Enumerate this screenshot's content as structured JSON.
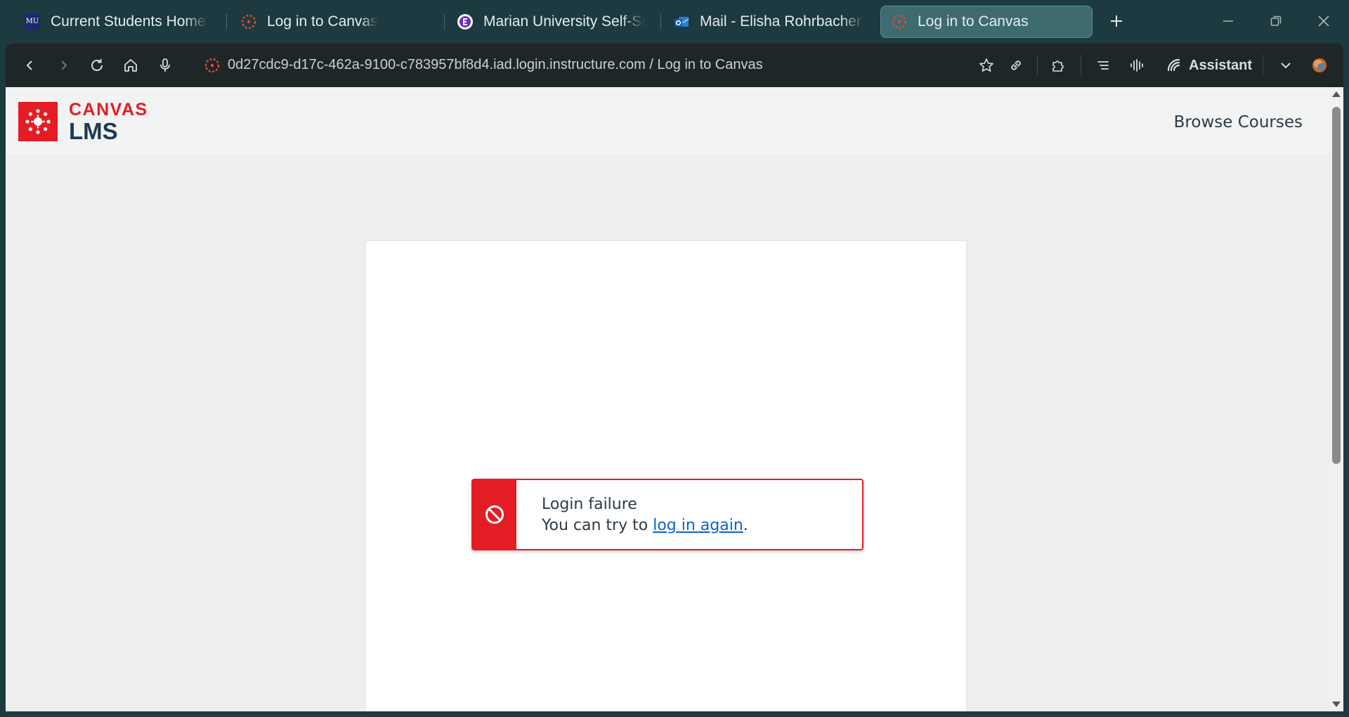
{
  "browser": {
    "tabs": [
      {
        "label": "Current Students Home | M",
        "icon": "mu-logo-icon",
        "active": false
      },
      {
        "label": "Log in to Canvas",
        "icon": "canvas-icon",
        "active": false
      },
      {
        "label": "Marian University Self-Service",
        "icon": "ellucian-icon",
        "active": false
      },
      {
        "label": "Mail - Elisha Rohrbacher - Outlook",
        "icon": "outlook-icon",
        "active": false
      },
      {
        "label": "Log in to Canvas",
        "icon": "canvas-icon",
        "active": true
      }
    ],
    "address_bar": {
      "url": "0d27cdc9-d17c-462a-9100-c783957bf8d4.iad.login.instructure.com / Log in to Canvas"
    },
    "assistant_label": "Assistant",
    "mu_icon_text": "MU"
  },
  "page": {
    "logo": {
      "canvas": "CANVAS",
      "lms": "LMS"
    },
    "header_link": "Browse Courses",
    "alert": {
      "title": "Login failure",
      "message_prefix": "You can try to ",
      "link_text": "log in again",
      "message_suffix": "."
    }
  },
  "colors": {
    "brand_red": "#e41c24",
    "link_blue": "#0b63c8",
    "chrome_bg": "#1c3a3f",
    "active_tab": "#3d6b70"
  }
}
